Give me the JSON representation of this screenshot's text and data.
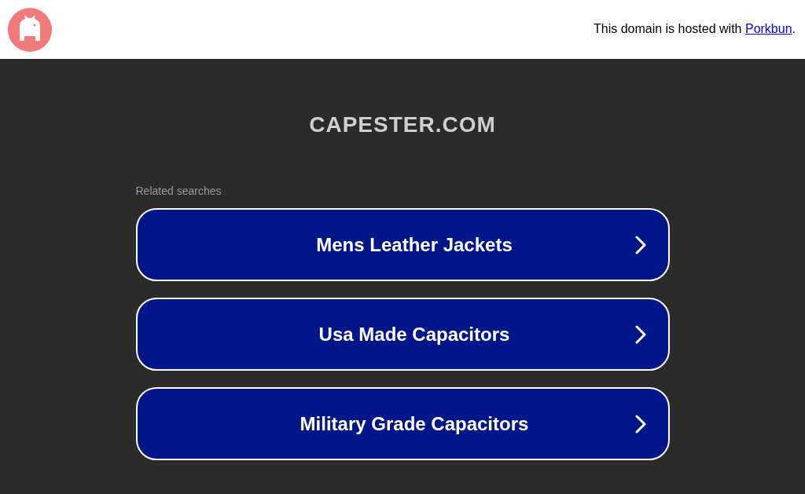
{
  "header": {
    "hosting_note": {
      "text": "This domain is hosted with ",
      "link": "Porkbun",
      "suffix": "."
    }
  },
  "domain_title": "CAPESTER.COM",
  "related_searches": {
    "label": "Related searches",
    "items": [
      {
        "label": "Mens Leather Jackets"
      },
      {
        "label": "Usa Made Capacitors"
      },
      {
        "label": "Military Grade Capacitors"
      }
    ]
  }
}
